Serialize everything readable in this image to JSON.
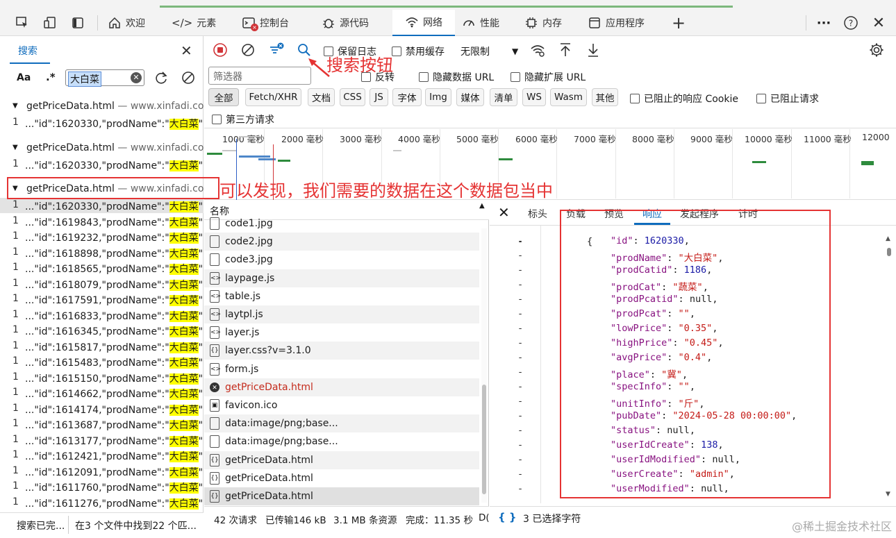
{
  "tabs": [
    {
      "label": "欢迎",
      "icon": "home-icon"
    },
    {
      "label": "元素",
      "icon": "code-icon"
    },
    {
      "label": "控制台",
      "icon": "console-icon"
    },
    {
      "label": "源代码",
      "icon": "bug-icon"
    },
    {
      "label": "网络",
      "icon": "wifi-icon"
    },
    {
      "label": "性能",
      "icon": "gauge-icon"
    },
    {
      "label": "内存",
      "icon": "chip-icon"
    },
    {
      "label": "应用程序",
      "icon": "app-window-icon"
    }
  ],
  "search_panel": {
    "title": "搜索",
    "case_label": "Aa",
    "regex_label": ".*",
    "query": "大白菜",
    "results": [
      {
        "file": "getPriceData.html",
        "domain": "— www.xinfadi.co..."
      },
      {
        "file": "getPriceData.html",
        "domain": "— www.xinfadi.co..."
      },
      {
        "file": "getPriceData.html",
        "domain": "— www.xinfadi.co..."
      }
    ],
    "line_prefix": "1",
    "match_first": {
      "before": "...\"id\":1620330,\"prodName\":\"",
      "hit": "大白菜",
      "after": "\",..."
    },
    "matches": [
      {
        "before": "...\"id\":1620330,\"prodName\":\"",
        "hit": "大白菜",
        "after": "\","
      },
      {
        "before": "...\"id\":1619843,\"prodName\":\"",
        "hit": "大白菜",
        "after": "\","
      },
      {
        "before": "...\"id\":1619232,\"prodName\":\"",
        "hit": "大白菜",
        "after": "\","
      },
      {
        "before": "...\"id\":1618898,\"prodName\":\"",
        "hit": "大白菜",
        "after": "\","
      },
      {
        "before": "...\"id\":1618565,\"prodName\":\"",
        "hit": "大白菜",
        "after": "\","
      },
      {
        "before": "...\"id\":1618079,\"prodName\":\"",
        "hit": "大白菜",
        "after": "\","
      },
      {
        "before": "...\"id\":1617591,\"prodName\":\"",
        "hit": "大白菜",
        "after": "\","
      },
      {
        "before": "...\"id\":1616833,\"prodName\":\"",
        "hit": "大白菜",
        "after": "\","
      },
      {
        "before": "...\"id\":1616345,\"prodName\":\"",
        "hit": "大白菜",
        "after": "\","
      },
      {
        "before": "...\"id\":1615817,\"prodName\":\"",
        "hit": "大白菜",
        "after": "\","
      },
      {
        "before": "...\"id\":1615483,\"prodName\":\"",
        "hit": "大白菜",
        "after": "\","
      },
      {
        "before": "...\"id\":1615150,\"prodName\":\"",
        "hit": "大白菜",
        "after": "\","
      },
      {
        "before": "...\"id\":1614662,\"prodName\":\"",
        "hit": "大白菜",
        "after": "\","
      },
      {
        "before": "...\"id\":1614174,\"prodName\":\"",
        "hit": "大白菜",
        "after": "\","
      },
      {
        "before": "...\"id\":1613687,\"prodName\":\"",
        "hit": "大白菜",
        "after": "\","
      },
      {
        "before": "...\"id\":1613177,\"prodName\":\"",
        "hit": "大白菜",
        "after": "\","
      },
      {
        "before": "...\"id\":1612421,\"prodName\":\"",
        "hit": "大白菜",
        "after": "\","
      },
      {
        "before": "...\"id\":1612091,\"prodName\":\"",
        "hit": "大白菜",
        "after": "\","
      },
      {
        "before": "...\"id\":1611760,\"prodName\":\"",
        "hit": "大白菜",
        "after": "\","
      },
      {
        "before": "...\"id\":1611276,\"prodName\":\"",
        "hit": "大白菜",
        "after": "\","
      }
    ],
    "status_left": "搜索已完...",
    "status_right": "在3 个文件中找到22 个匹..."
  },
  "network": {
    "preserve_log": "保留日志",
    "disable_cache": "禁用缓存",
    "throttle": "无限制",
    "filter_placeholder": "筛选器",
    "invert": "反转",
    "hide_data_url": "隐藏数据 URL",
    "hide_ext_url": "隐藏扩展 URL",
    "types": [
      "全部",
      "Fetch/XHR",
      "文档",
      "CSS",
      "JS",
      "字体",
      "Img",
      "媒体",
      "清单",
      "WS",
      "Wasm",
      "其他"
    ],
    "blocked_cookie": "已阻止的响应 Cookie",
    "blocked_req": "已阻止请求",
    "third_party": "第三方请求",
    "timeline_ticks": [
      "1000 毫秒",
      "2000 毫秒",
      "3000 毫秒",
      "4000 毫秒",
      "5000 毫秒",
      "6000 毫秒",
      "7000 毫秒",
      "8000 毫秒",
      "9000 毫秒",
      "10000 毫秒",
      "11000 毫秒",
      "12000"
    ],
    "name_header": "名称",
    "files": [
      {
        "name": "code1.jpg",
        "kind": "file"
      },
      {
        "name": "code2.jpg",
        "kind": "file"
      },
      {
        "name": "code3.jpg",
        "kind": "file"
      },
      {
        "name": "laypage.js",
        "kind": "script"
      },
      {
        "name": "table.js",
        "kind": "script"
      },
      {
        "name": "laytpl.js",
        "kind": "script"
      },
      {
        "name": "layer.js",
        "kind": "script"
      },
      {
        "name": "layer.css?v=3.1.0",
        "kind": "style"
      },
      {
        "name": "form.js",
        "kind": "script"
      },
      {
        "name": "getPriceData.html",
        "kind": "error"
      },
      {
        "name": "favicon.ico",
        "kind": "image"
      },
      {
        "name": "data:image/png;base...",
        "kind": "file"
      },
      {
        "name": "data:image/png;base...",
        "kind": "file"
      },
      {
        "name": "getPriceData.html",
        "kind": "xhr"
      },
      {
        "name": "getPriceData.html",
        "kind": "xhr"
      },
      {
        "name": "getPriceData.html",
        "kind": "xhr"
      }
    ],
    "status": {
      "requests": "42 次请求",
      "transferred": "已传输146 kB",
      "resources": "3.1 MB 条资源",
      "finish": "完成：11.35 秒",
      "dc": "D("
    }
  },
  "detail": {
    "tabs": [
      "标头",
      "负载",
      "预览",
      "响应",
      "发起程序",
      "计时"
    ],
    "active_tab": "响应",
    "open_brace": "{",
    "fields": [
      {
        "key": "\"id\"",
        "value": "1620330",
        "type": "num"
      },
      {
        "key": "\"prodName\"",
        "value": "\"大白菜\"",
        "type": "str"
      },
      {
        "key": "\"prodCatid\"",
        "value": "1186",
        "type": "num"
      },
      {
        "key": "\"prodCat\"",
        "value": "\"蔬菜\"",
        "type": "str"
      },
      {
        "key": "\"prodPcatid\"",
        "value": "null",
        "type": "null"
      },
      {
        "key": "\"prodPcat\"",
        "value": "\"\"",
        "type": "str"
      },
      {
        "key": "\"lowPrice\"",
        "value": "\"0.35\"",
        "type": "str"
      },
      {
        "key": "\"highPrice\"",
        "value": "\"0.45\"",
        "type": "str"
      },
      {
        "key": "\"avgPrice\"",
        "value": "\"0.4\"",
        "type": "str"
      },
      {
        "key": "\"place\"",
        "value": "\"冀\"",
        "type": "str"
      },
      {
        "key": "\"specInfo\"",
        "value": "\"\"",
        "type": "str"
      },
      {
        "key": "\"unitInfo\"",
        "value": "\"斤\"",
        "type": "str"
      },
      {
        "key": "\"pubDate\"",
        "value": "\"2024-05-28 00:00:00\"",
        "type": "str"
      },
      {
        "key": "\"status\"",
        "value": "null",
        "type": "null"
      },
      {
        "key": "\"userIdCreate\"",
        "value": "138",
        "type": "num"
      },
      {
        "key": "\"userIdModified\"",
        "value": "null",
        "type": "null"
      },
      {
        "key": "\"userCreate\"",
        "value": "\"admin\"",
        "type": "str"
      },
      {
        "key": "\"userModified\"",
        "value": "null",
        "type": "null"
      }
    ],
    "status_braces": "{ }",
    "status_text": "3 已选择字符"
  },
  "annotations": {
    "search_button": "搜索按钮",
    "packet_found": "可以发现，我们需要的数据在这个数据包当中"
  },
  "watermark": "@稀土掘金技术社区",
  "colors": {
    "accent": "#0f6cbd",
    "annotation": "#e53333",
    "highlight": "#ffff00"
  }
}
